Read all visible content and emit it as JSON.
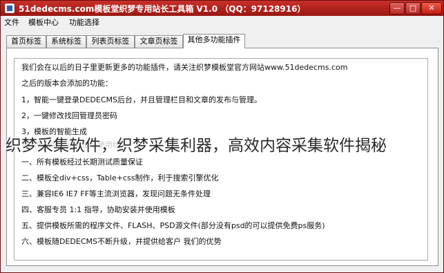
{
  "window": {
    "title": "51dedecms.com模板堂织梦专用站长工具箱 V1.0 （QQ：97128916）",
    "buttons": {
      "minimize": "—",
      "maximize": "□",
      "close": "✕"
    }
  },
  "menu": [
    "文件",
    "模板中心",
    "功能选择"
  ],
  "tabs": [
    "首页标签",
    "系统标签",
    "列表页标签",
    "文章页标签",
    "其他多功能插件"
  ],
  "active_tab_index": 4,
  "content_lines": [
    "我们会在以后的日子里更新更多的功能插件，请关注织梦模板堂官方网站www.51dedecms.com",
    "之后的版本会添加的功能：",
    "1，智能一键登录DEDECMS后台，并且管理栏目和文章的发布与管理。",
    "2，一键修改找回管理员密码",
    "3，模板的智能生成",
    "一、所有模板经过长期测试质量保证",
    "二、模板全div+css，Table+css制作，利于搜索引擎优化",
    "三、兼容IE6 IE7 FF等主流浏览器，发现问题无条件处理",
    "四、客服专员 1:1 指导，协助安装并使用模板",
    "五、提供模板所需的程序文件、FLASH、PSD源文件(部分没有psd的可以提供免费ps服务)",
    "六、模板随DEDECMS不断升级，并提供给客户 我们的优势"
  ],
  "faded_line": "我们的优势，让你放心使用给我",
  "watermark": "织梦采集软件，织梦采集利器，高效内容采集软件揭秘",
  "colors": {
    "titlebar": "#b5231d",
    "panel_bg": "#ffffff",
    "chrome_bg": "#f0f0f0"
  }
}
